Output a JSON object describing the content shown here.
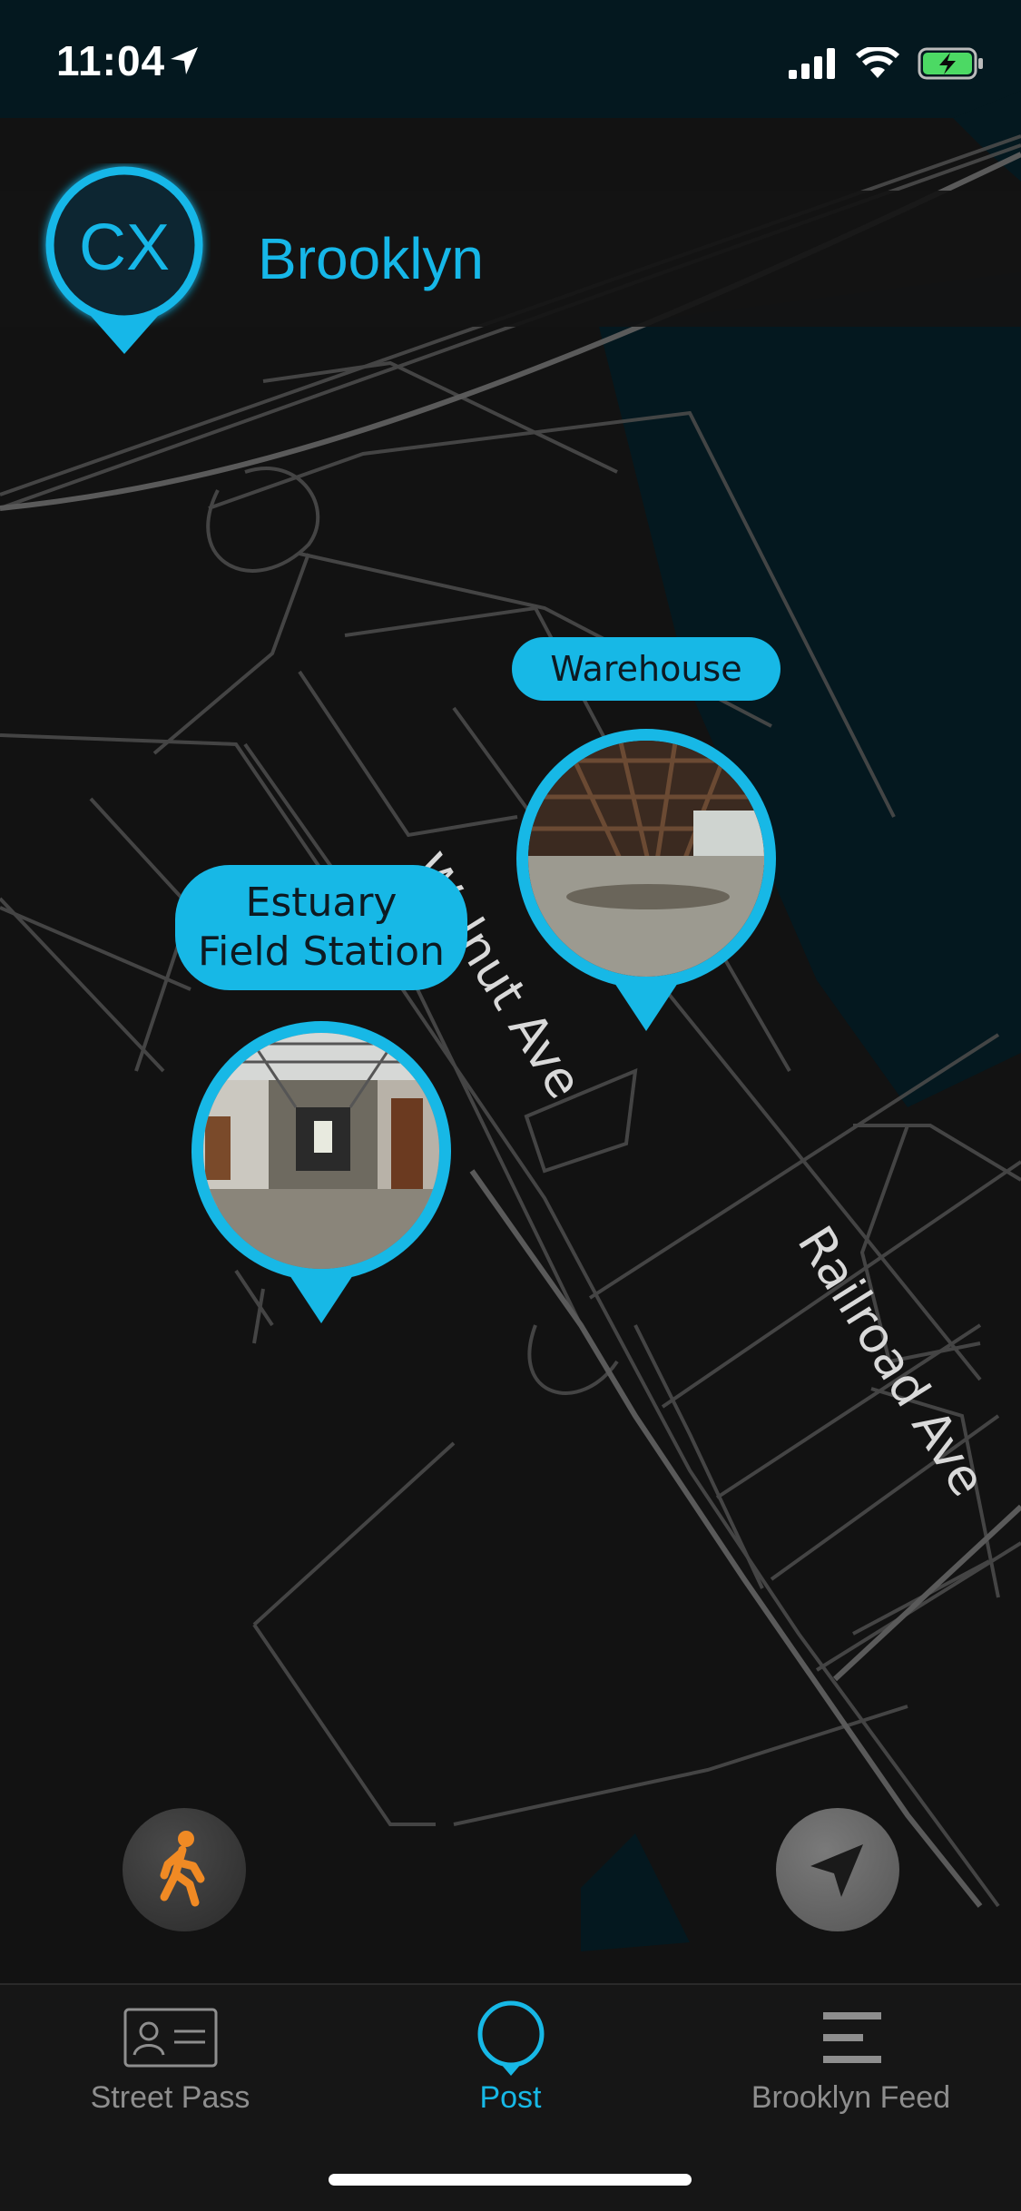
{
  "status_bar": {
    "time": "11:04"
  },
  "header": {
    "badge": "CX",
    "city": "Brooklyn"
  },
  "map": {
    "streets": [
      "Walnut Ave",
      "Railroad Ave"
    ],
    "places": [
      {
        "label_lines": [
          "Warehouse"
        ]
      },
      {
        "label_lines": [
          "Estuary",
          "Field Station"
        ]
      }
    ]
  },
  "controls": {
    "walk_icon": "walking-person-icon",
    "locate_icon": "location-arrow-icon"
  },
  "tabbar": {
    "items": [
      {
        "label": "Street Pass",
        "icon": "id-card-icon"
      },
      {
        "label": "Post",
        "icon": "pin-outline-icon",
        "active": true
      },
      {
        "label": "Brooklyn Feed",
        "icon": "feed-lines-icon"
      }
    ]
  },
  "colors": {
    "accent": "#17b8e6",
    "walk": "#f08a24",
    "water": "#04181f",
    "background": "#121212"
  }
}
